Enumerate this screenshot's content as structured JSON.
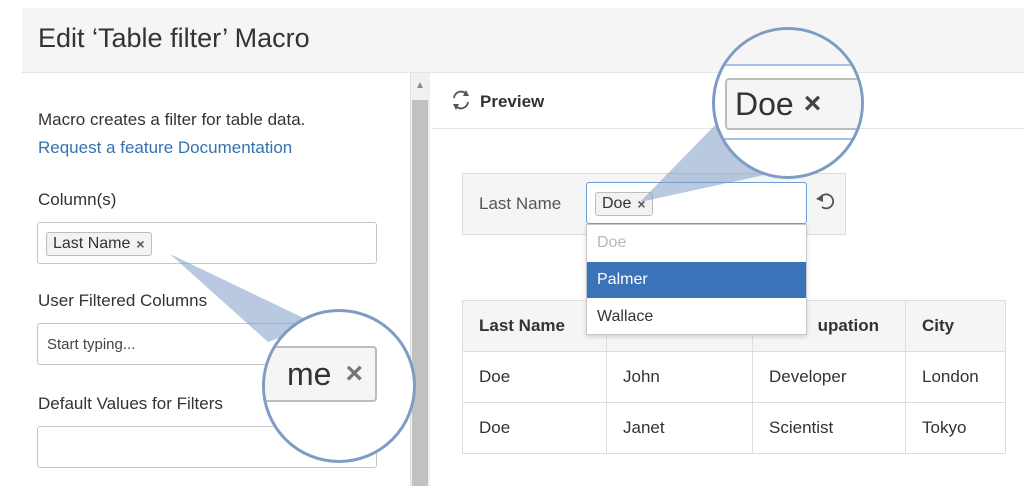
{
  "header": {
    "title": "Edit ‘Table filter’ Macro"
  },
  "left": {
    "description": "Macro creates a filter for table data.",
    "link_request": "Request a feature",
    "link_docs": "Documentation",
    "columns_label": "Column(s)",
    "columns_tag": "Last Name",
    "user_filtered_label": "User Filtered Columns",
    "user_filtered_placeholder": "Start typing...",
    "defaults_label": "Default Values for Filters",
    "magnifier_text": "me"
  },
  "preview": {
    "title": "Preview",
    "filter_label": "Last Name",
    "filter_tag": "Doe",
    "magnifier_text": "Doe",
    "dropdown": [
      "Doe",
      "Palmer",
      "Wallace"
    ]
  },
  "table": {
    "headers": [
      "Last Name",
      "",
      "Occupation",
      "City"
    ],
    "header_visible_occupation": "upation",
    "rows": [
      [
        "Doe",
        "John",
        "Developer",
        "London"
      ],
      [
        "Doe",
        "Janet",
        "Scientist",
        "Tokyo"
      ]
    ]
  },
  "icons": {
    "close": "×",
    "refresh": "refresh-icon",
    "undo": "undo-icon"
  },
  "colors": {
    "link": "#3572b0",
    "selected": "#3b73b9",
    "magnifier_ring": "#7f9cc4"
  }
}
